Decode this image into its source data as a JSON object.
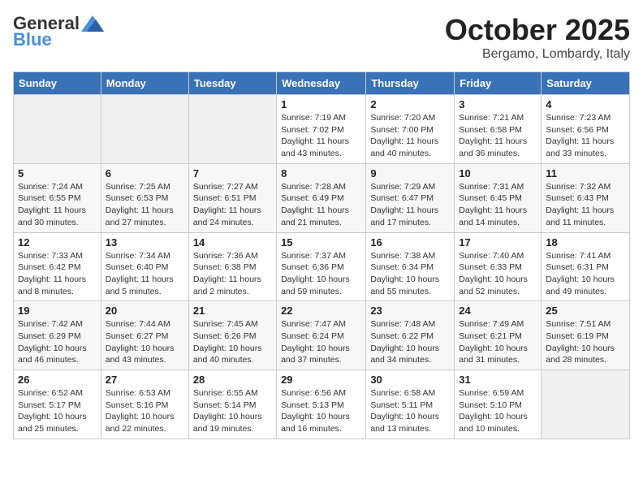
{
  "header": {
    "logo_general": "General",
    "logo_blue": "Blue",
    "month_title": "October 2025",
    "location": "Bergamo, Lombardy, Italy"
  },
  "weekdays": [
    "Sunday",
    "Monday",
    "Tuesday",
    "Wednesday",
    "Thursday",
    "Friday",
    "Saturday"
  ],
  "weeks": [
    [
      {
        "day": "",
        "info": ""
      },
      {
        "day": "",
        "info": ""
      },
      {
        "day": "",
        "info": ""
      },
      {
        "day": "1",
        "info": "Sunrise: 7:19 AM\nSunset: 7:02 PM\nDaylight: 11 hours and 43 minutes."
      },
      {
        "day": "2",
        "info": "Sunrise: 7:20 AM\nSunset: 7:00 PM\nDaylight: 11 hours and 40 minutes."
      },
      {
        "day": "3",
        "info": "Sunrise: 7:21 AM\nSunset: 6:58 PM\nDaylight: 11 hours and 36 minutes."
      },
      {
        "day": "4",
        "info": "Sunrise: 7:23 AM\nSunset: 6:56 PM\nDaylight: 11 hours and 33 minutes."
      }
    ],
    [
      {
        "day": "5",
        "info": "Sunrise: 7:24 AM\nSunset: 6:55 PM\nDaylight: 11 hours and 30 minutes."
      },
      {
        "day": "6",
        "info": "Sunrise: 7:25 AM\nSunset: 6:53 PM\nDaylight: 11 hours and 27 minutes."
      },
      {
        "day": "7",
        "info": "Sunrise: 7:27 AM\nSunset: 6:51 PM\nDaylight: 11 hours and 24 minutes."
      },
      {
        "day": "8",
        "info": "Sunrise: 7:28 AM\nSunset: 6:49 PM\nDaylight: 11 hours and 21 minutes."
      },
      {
        "day": "9",
        "info": "Sunrise: 7:29 AM\nSunset: 6:47 PM\nDaylight: 11 hours and 17 minutes."
      },
      {
        "day": "10",
        "info": "Sunrise: 7:31 AM\nSunset: 6:45 PM\nDaylight: 11 hours and 14 minutes."
      },
      {
        "day": "11",
        "info": "Sunrise: 7:32 AM\nSunset: 6:43 PM\nDaylight: 11 hours and 11 minutes."
      }
    ],
    [
      {
        "day": "12",
        "info": "Sunrise: 7:33 AM\nSunset: 6:42 PM\nDaylight: 11 hours and 8 minutes."
      },
      {
        "day": "13",
        "info": "Sunrise: 7:34 AM\nSunset: 6:40 PM\nDaylight: 11 hours and 5 minutes."
      },
      {
        "day": "14",
        "info": "Sunrise: 7:36 AM\nSunset: 6:38 PM\nDaylight: 11 hours and 2 minutes."
      },
      {
        "day": "15",
        "info": "Sunrise: 7:37 AM\nSunset: 6:36 PM\nDaylight: 10 hours and 59 minutes."
      },
      {
        "day": "16",
        "info": "Sunrise: 7:38 AM\nSunset: 6:34 PM\nDaylight: 10 hours and 55 minutes."
      },
      {
        "day": "17",
        "info": "Sunrise: 7:40 AM\nSunset: 6:33 PM\nDaylight: 10 hours and 52 minutes."
      },
      {
        "day": "18",
        "info": "Sunrise: 7:41 AM\nSunset: 6:31 PM\nDaylight: 10 hours and 49 minutes."
      }
    ],
    [
      {
        "day": "19",
        "info": "Sunrise: 7:42 AM\nSunset: 6:29 PM\nDaylight: 10 hours and 46 minutes."
      },
      {
        "day": "20",
        "info": "Sunrise: 7:44 AM\nSunset: 6:27 PM\nDaylight: 10 hours and 43 minutes."
      },
      {
        "day": "21",
        "info": "Sunrise: 7:45 AM\nSunset: 6:26 PM\nDaylight: 10 hours and 40 minutes."
      },
      {
        "day": "22",
        "info": "Sunrise: 7:47 AM\nSunset: 6:24 PM\nDaylight: 10 hours and 37 minutes."
      },
      {
        "day": "23",
        "info": "Sunrise: 7:48 AM\nSunset: 6:22 PM\nDaylight: 10 hours and 34 minutes."
      },
      {
        "day": "24",
        "info": "Sunrise: 7:49 AM\nSunset: 6:21 PM\nDaylight: 10 hours and 31 minutes."
      },
      {
        "day": "25",
        "info": "Sunrise: 7:51 AM\nSunset: 6:19 PM\nDaylight: 10 hours and 28 minutes."
      }
    ],
    [
      {
        "day": "26",
        "info": "Sunrise: 6:52 AM\nSunset: 5:17 PM\nDaylight: 10 hours and 25 minutes."
      },
      {
        "day": "27",
        "info": "Sunrise: 6:53 AM\nSunset: 5:16 PM\nDaylight: 10 hours and 22 minutes."
      },
      {
        "day": "28",
        "info": "Sunrise: 6:55 AM\nSunset: 5:14 PM\nDaylight: 10 hours and 19 minutes."
      },
      {
        "day": "29",
        "info": "Sunrise: 6:56 AM\nSunset: 5:13 PM\nDaylight: 10 hours and 16 minutes."
      },
      {
        "day": "30",
        "info": "Sunrise: 6:58 AM\nSunset: 5:11 PM\nDaylight: 10 hours and 13 minutes."
      },
      {
        "day": "31",
        "info": "Sunrise: 6:59 AM\nSunset: 5:10 PM\nDaylight: 10 hours and 10 minutes."
      },
      {
        "day": "",
        "info": ""
      }
    ]
  ]
}
